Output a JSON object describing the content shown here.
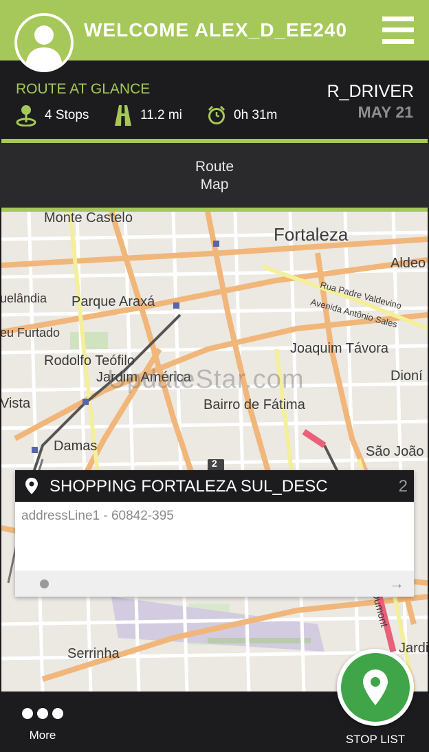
{
  "header": {
    "welcome_text": "WELCOME ALEX_D_EE240",
    "colors": {
      "accent": "#a6c85a",
      "dark": "#1c1c1e"
    }
  },
  "glance": {
    "title": "ROUTE AT GLANCE",
    "stops": "4 Stops",
    "distance": "11.2 mi",
    "duration": "0h 31m",
    "driver": "R_DRIVER",
    "date": "MAY 21"
  },
  "tab": {
    "line1": "Route",
    "line2": "Map"
  },
  "map": {
    "labels": [
      "Monte Castelo",
      "Fortaleza",
      "Aldeo",
      "uelândia",
      "Parque Araxá",
      "Rua Padre Valdevino",
      "Avenida Antônio Sales",
      "eu Furtado",
      "Joaquim Távora",
      "Rodolfo Teófilo",
      "Jardim América",
      "Dioní",
      "Vista",
      "Bairro de Fátima",
      "Damas",
      "São João",
      "2",
      "Serrinha",
      "Dumont",
      "Jardi"
    ],
    "watermark": "UpdateStar.com"
  },
  "stop_card": {
    "title": "SHOPPING FORTALEZA SUL_DESC",
    "number": "2",
    "address": "addressLine1 - 60842-395",
    "arrow": "→"
  },
  "footer": {
    "more_label": "More",
    "stop_list_label": "STOP LIST"
  },
  "icons": [
    "avatar-icon",
    "hamburger-menu-icon",
    "map-pin-stop-icon",
    "road-icon",
    "alarm-clock-icon",
    "location-pin-icon",
    "more-dots-icon",
    "map-marker-icon"
  ]
}
